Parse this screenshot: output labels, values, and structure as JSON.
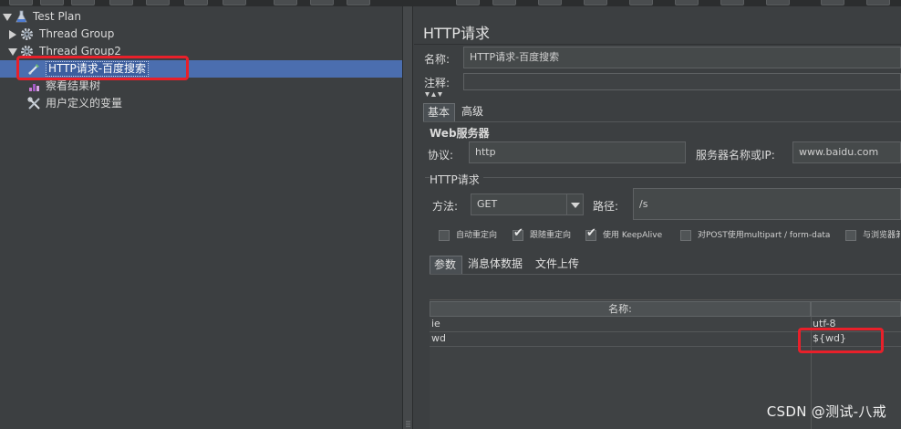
{
  "tree": {
    "items": [
      {
        "label": "Test Plan",
        "icon": "test-plan-icon"
      },
      {
        "label": "Thread Group",
        "icon": "gear-icon"
      },
      {
        "label": "Thread Group2",
        "icon": "gear-icon"
      },
      {
        "label": "HTTP请求-百度搜索",
        "icon": "http-sampler-icon"
      },
      {
        "label": "察看结果树",
        "icon": "results-tree-icon"
      },
      {
        "label": "用户定义的变量",
        "icon": "variables-icon"
      }
    ]
  },
  "panel": {
    "title": "HTTP请求",
    "name_label": "名称:",
    "name_value": "HTTP请求-百度搜索",
    "comment_label": "注释:",
    "tabs": [
      "基本",
      "高级"
    ],
    "web_server_title": "Web服务器",
    "protocol_label": "协议:",
    "protocol_value": "http",
    "server_label": "服务器名称或IP:",
    "server_value": "www.baidu.com",
    "http_request_title": "HTTP请求",
    "method_label": "方法:",
    "method_value": "GET",
    "path_label": "路径:",
    "path_value": "/s",
    "checkboxes": [
      {
        "label": "自动重定向",
        "checked": false
      },
      {
        "label": "跟随重定向",
        "checked": true
      },
      {
        "label": "使用 KeepAlive",
        "checked": true
      },
      {
        "label": "对POST使用multipart / form-data",
        "checked": false
      },
      {
        "label": "与浏览器兼",
        "checked": false
      }
    ],
    "param_tabs": [
      "参数",
      "消息体数据",
      "文件上传"
    ],
    "table": {
      "headers": [
        "名称:",
        ""
      ],
      "rows": [
        {
          "name": "ie",
          "value": "utf-8"
        },
        {
          "name": "wd",
          "value": "${wd}"
        }
      ]
    }
  },
  "watermark": "CSDN @测试-八戒",
  "colors": {
    "background": "#3c3f41",
    "selection": "#4b6eaf",
    "highlight_box": "#e8202a"
  }
}
